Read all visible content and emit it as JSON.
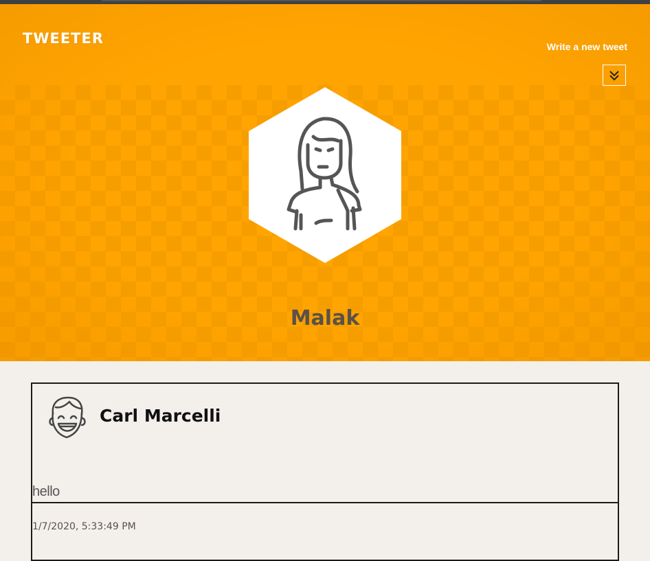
{
  "header": {
    "brand": "TWEETER",
    "write_link": "Write a new tweet",
    "toggle_icon": "double-chevron-down-icon"
  },
  "profile": {
    "name": "Malak",
    "avatar_icon": "woman-avatar-icon"
  },
  "colors": {
    "hero": "#ffa400",
    "name": "#5a5148",
    "background": "#f3f0ec"
  },
  "tweets": [
    {
      "author": "Carl Marcelli",
      "avatar_icon": "laughing-man-avatar-icon",
      "content": "hello",
      "timestamp": "1/7/2020, 5:33:49 PM"
    }
  ]
}
